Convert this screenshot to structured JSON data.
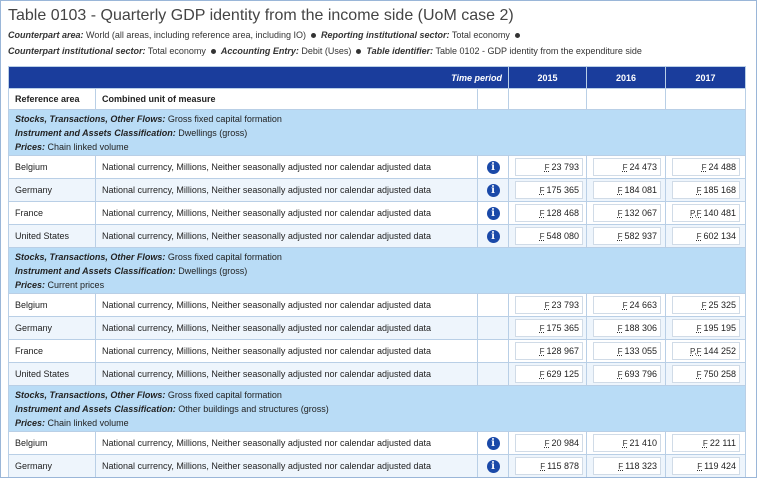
{
  "title": "Table 0103 - Quarterly GDP identity from the income side (UoM case 2)",
  "meta": {
    "line1": [
      {
        "label": "Counterpart area:",
        "value": "World (all areas, including reference area, including IO)"
      },
      {
        "label": "Reporting institutional sector:",
        "value": "Total economy"
      }
    ],
    "line2": [
      {
        "label": "Counterpart institutional sector:",
        "value": "Total economy"
      },
      {
        "label": "Accounting Entry:",
        "value": "Debit (Uses)"
      },
      {
        "label": "Table identifier:",
        "value": "Table 0102 - GDP identity from the expenditure side"
      }
    ]
  },
  "table": {
    "time_period_label": "Time period",
    "years": [
      "2015",
      "2016",
      "2017"
    ],
    "col_reference_area": "Reference area",
    "col_unit": "Combined unit of measure",
    "groups": [
      {
        "lines": [
          {
            "label": "Stocks, Transactions, Other Flows:",
            "value": "Gross fixed capital formation"
          },
          {
            "label": "Instrument and Assets Classification:",
            "value": "Dwellings (gross)"
          },
          {
            "label": "Prices:",
            "value": "Chain linked volume"
          }
        ],
        "rows": [
          {
            "area": "Belgium",
            "unit": "National currency, Millions, Neither seasonally adjusted nor calendar adjusted data",
            "info": true,
            "values": [
              {
                "flag": "F",
                "v": "23 793"
              },
              {
                "flag": "F",
                "v": "24 473"
              },
              {
                "flag": "F",
                "v": "24 488"
              }
            ]
          },
          {
            "area": "Germany",
            "unit": "National currency, Millions, Neither seasonally adjusted nor calendar adjusted data",
            "info": true,
            "values": [
              {
                "flag": "F",
                "v": "175 365"
              },
              {
                "flag": "F",
                "v": "184 081"
              },
              {
                "flag": "F",
                "v": "185 168"
              }
            ]
          },
          {
            "area": "France",
            "unit": "National currency, Millions, Neither seasonally adjusted nor calendar adjusted data",
            "info": true,
            "values": [
              {
                "flag": "F",
                "v": "128 468"
              },
              {
                "flag": "F",
                "v": "132 067"
              },
              {
                "flag": "P,F",
                "v": "140 481"
              }
            ]
          },
          {
            "area": "United States",
            "unit": "National currency, Millions, Neither seasonally adjusted nor calendar adjusted data",
            "info": true,
            "values": [
              {
                "flag": "F",
                "v": "548 080"
              },
              {
                "flag": "F",
                "v": "582 937"
              },
              {
                "flag": "F",
                "v": "602 134"
              }
            ]
          }
        ]
      },
      {
        "lines": [
          {
            "label": "Stocks, Transactions, Other Flows:",
            "value": "Gross fixed capital formation"
          },
          {
            "label": "Instrument and Assets Classification:",
            "value": "Dwellings (gross)"
          },
          {
            "label": "Prices:",
            "value": "Current prices"
          }
        ],
        "rows": [
          {
            "area": "Belgium",
            "unit": "National currency, Millions, Neither seasonally adjusted nor calendar adjusted data",
            "info": false,
            "values": [
              {
                "flag": "F",
                "v": "23 793"
              },
              {
                "flag": "F",
                "v": "24 663"
              },
              {
                "flag": "F",
                "v": "25 325"
              }
            ]
          },
          {
            "area": "Germany",
            "unit": "National currency, Millions, Neither seasonally adjusted nor calendar adjusted data",
            "info": false,
            "values": [
              {
                "flag": "F",
                "v": "175 365"
              },
              {
                "flag": "F",
                "v": "188 306"
              },
              {
                "flag": "F",
                "v": "195 195"
              }
            ]
          },
          {
            "area": "France",
            "unit": "National currency, Millions, Neither seasonally adjusted nor calendar adjusted data",
            "info": false,
            "values": [
              {
                "flag": "F",
                "v": "128 967"
              },
              {
                "flag": "F",
                "v": "133 055"
              },
              {
                "flag": "P,F",
                "v": "144 252"
              }
            ]
          },
          {
            "area": "United States",
            "unit": "National currency, Millions, Neither seasonally adjusted nor calendar adjusted data",
            "info": false,
            "values": [
              {
                "flag": "F",
                "v": "629 125"
              },
              {
                "flag": "F",
                "v": "693 796"
              },
              {
                "flag": "F",
                "v": "750 258"
              }
            ]
          }
        ]
      },
      {
        "lines": [
          {
            "label": "Stocks, Transactions, Other Flows:",
            "value": "Gross fixed capital formation"
          },
          {
            "label": "Instrument and Assets Classification:",
            "value": "Other buildings and structures (gross)"
          },
          {
            "label": "Prices:",
            "value": "Chain linked volume"
          }
        ],
        "rows": [
          {
            "area": "Belgium",
            "unit": "National currency, Millions, Neither seasonally adjusted nor calendar adjusted data",
            "info": true,
            "values": [
              {
                "flag": "F",
                "v": "20 984"
              },
              {
                "flag": "F",
                "v": "21 410"
              },
              {
                "flag": "F",
                "v": "22 111"
              }
            ]
          },
          {
            "area": "Germany",
            "unit": "National currency, Millions, Neither seasonally adjusted nor calendar adjusted data",
            "info": true,
            "values": [
              {
                "flag": "F",
                "v": "115 878"
              },
              {
                "flag": "F",
                "v": "118 323"
              },
              {
                "flag": "F",
                "v": "119 424"
              }
            ]
          }
        ]
      }
    ]
  },
  "icons": {
    "info": "info-icon",
    "separator": "bullet-dot"
  },
  "colors": {
    "header_bg": "#1a3d9c",
    "group_bg": "#b9dcf6",
    "border": "#b9cfe6",
    "info_icon": "#1a49a8"
  }
}
